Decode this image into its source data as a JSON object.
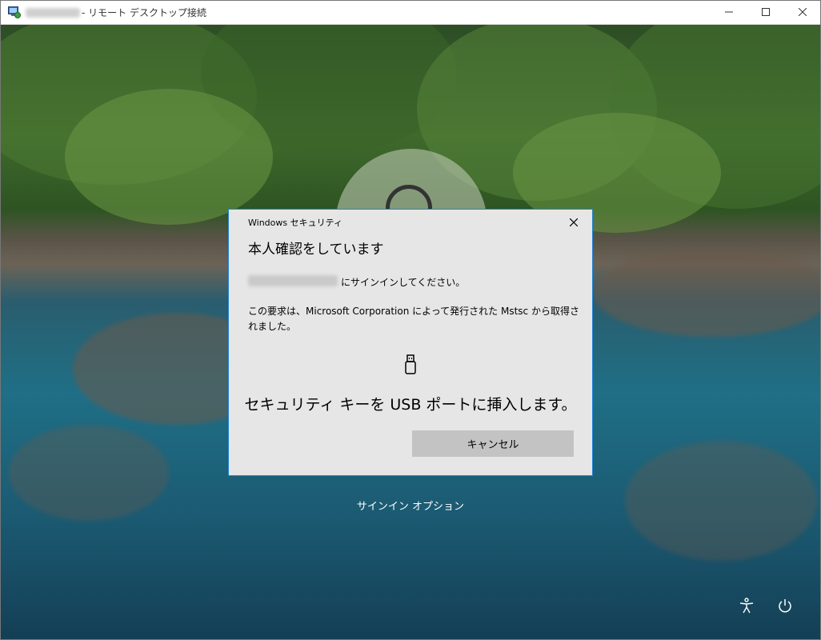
{
  "window": {
    "title": "- リモート デスクトップ接続"
  },
  "dialog": {
    "title": "Windows セキュリティ",
    "heading": "本人確認をしています",
    "signin_prompt": "にサインインしてください。",
    "request_text": "この要求は、Microsoft Corporation によって発行された Mstsc から取得されました。",
    "insert_instruction": "セキュリティ キーを USB ポートに挿入します。",
    "cancel_label": "キャンセル"
  },
  "lockscreen": {
    "signin_options_label": "サインイン オプション"
  },
  "icons": {
    "app": "remote-desktop-icon",
    "usb": "usb-key-icon",
    "accessibility": "accessibility-icon",
    "power": "power-icon"
  },
  "colors": {
    "dialog_border": "#1f84d8",
    "dialog_bg": "#e6e6e6",
    "button_bg": "#c3c3c3"
  }
}
